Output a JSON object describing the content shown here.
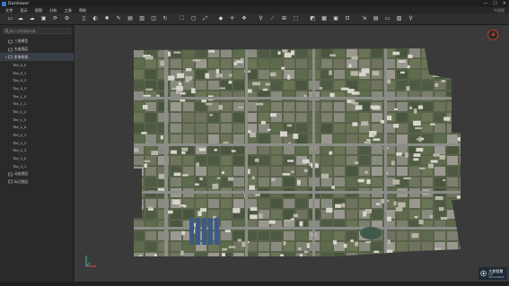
{
  "window": {
    "title": "DasViewer",
    "controls": [
      "—",
      "☐",
      "✕"
    ]
  },
  "menu": {
    "items": [
      "文件",
      "显示",
      "视图",
      "分析",
      "工具",
      "帮助"
    ],
    "right_text": "中国版"
  },
  "toolbar": {
    "icons": [
      "folder-open-icon",
      "cloud-open-icon",
      "cloud-icon",
      "save-icon",
      "refresh-icon",
      "settings-icon",
      "file-icon",
      "contrast-icon",
      "sun-icon",
      "draw-icon",
      "layer-icon",
      "layers-icon",
      "cube-icon",
      "rotate-icon",
      "fit-view-icon",
      "frame-icon",
      "maximize-icon",
      "select-point-icon",
      "crosshair-icon",
      "pan-icon",
      "marker-icon",
      "measure-line-icon",
      "ruler-icon",
      "box-3d-icon",
      "area-icon",
      "grid-icon",
      "camera-icon",
      "crop-icon",
      "transform-icon",
      "chart-icon",
      "window-icon",
      "image-icon",
      "search-icon"
    ]
  },
  "sidebar": {
    "search_placeholder": "输入名称搜索对象",
    "tree": [
      {
        "label": "三维模型",
        "level": 0,
        "icon": "model-3d-icon",
        "caret": ""
      },
      {
        "label": "矢量图层",
        "level": 0,
        "icon": "vector-layer-icon",
        "caret": ""
      },
      {
        "label": "影像数据",
        "level": 0,
        "icon": "folder-icon",
        "caret": "▾",
        "selected": true
      },
      {
        "label": "Tile_0_0",
        "level": 1
      },
      {
        "label": "Tile_0_1",
        "level": 1
      },
      {
        "label": "Tile_0_2",
        "level": 1
      },
      {
        "label": "Tile_0_3",
        "level": 1
      },
      {
        "label": "Tile_1_0",
        "level": 1
      },
      {
        "label": "Tile_1_1",
        "level": 1
      },
      {
        "label": "Tile_1_2",
        "level": 1
      },
      {
        "label": "Tile_1_3",
        "level": 1
      },
      {
        "label": "Tile_2_0",
        "level": 1
      },
      {
        "label": "Tile_2_1",
        "level": 1
      },
      {
        "label": "Tile_2_2",
        "level": 1
      },
      {
        "label": "Tile_2_3",
        "level": 1
      },
      {
        "label": "Tile_3_0",
        "level": 1
      },
      {
        "label": "Tile_3_1",
        "level": 1
      },
      {
        "label": "动态图层",
        "level": 0,
        "icon": "dynamic-layer-icon",
        "caret": ""
      },
      {
        "label": "标注图层",
        "level": 0,
        "icon": "label-layer-icon",
        "caret": ""
      }
    ]
  },
  "viewport": {
    "compass_label": "N",
    "axes": {
      "x_color": "#e74c3c",
      "y_color": "#2ecc71",
      "z_color": "#3498db"
    }
  },
  "brand": {
    "name": "大势智慧",
    "sub": "DAS INTELLIGENCE"
  },
  "colors": {
    "accent": "#3a7bd5",
    "compass": "#e74c3c",
    "viewport_bg": "#3a3a3a",
    "sidebar_bg": "#2a2a2a"
  }
}
